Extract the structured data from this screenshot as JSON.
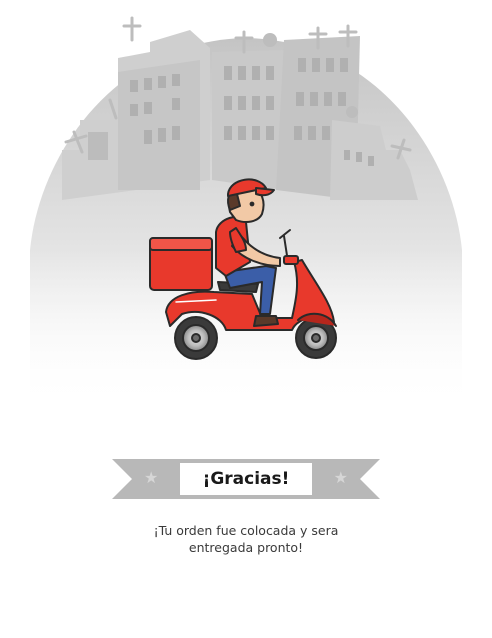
{
  "illustration": {
    "description_icon": "delivery-scooter-illustration",
    "colors": {
      "scooter_red": "#e8392c",
      "scooter_dark_red": "#b5261c",
      "building_gray": "#c8c8c8",
      "sky_gradient_top": "#bfbfbf",
      "sky_gradient_bottom": "#ffffff"
    }
  },
  "banner": {
    "title": "¡Gracias!",
    "star_glyph": "★",
    "color": "#b8b8b8"
  },
  "message": {
    "line1": "¡Tu orden fue colocada y sera",
    "line2": "entregada pronto!"
  }
}
